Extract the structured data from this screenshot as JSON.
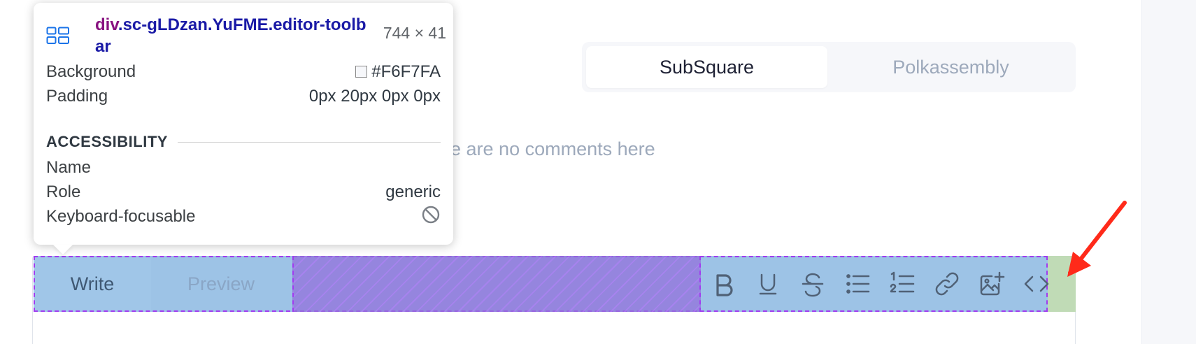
{
  "segmented": {
    "options": [
      {
        "label": "SubSquare",
        "active": true
      },
      {
        "label": "Polkassembly",
        "active": false
      }
    ]
  },
  "comments": {
    "empty_text": "ere are no comments here"
  },
  "editor": {
    "tabs": {
      "write": "Write",
      "preview": "Preview"
    },
    "toolbar_icons": [
      "bold-icon",
      "underline-icon",
      "strikethrough-icon",
      "bullet-list-icon",
      "numbered-list-icon",
      "link-icon",
      "image-add-icon",
      "code-icon"
    ]
  },
  "inspector": {
    "selector_tag": "div",
    "selector_classes": ".sc-gLDzan.YuFME.editor-toolbar",
    "size": "744 × 41",
    "rows": [
      {
        "key": "Background",
        "value": "#F6F7FA"
      },
      {
        "key": "Padding",
        "value": "0px 20px 0px 0px"
      }
    ],
    "section_title": "ACCESSIBILITY",
    "accessibility": [
      {
        "key": "Name",
        "value": ""
      },
      {
        "key": "Role",
        "value": "generic"
      },
      {
        "key": "Keyboard-focusable",
        "value": ""
      }
    ]
  },
  "colors": {
    "toolbar_bg": "#F6F7FA",
    "content_overlay": "#6FA8DC",
    "padding_overlay": "#93C47D",
    "arrow": "#FF2A1A"
  }
}
